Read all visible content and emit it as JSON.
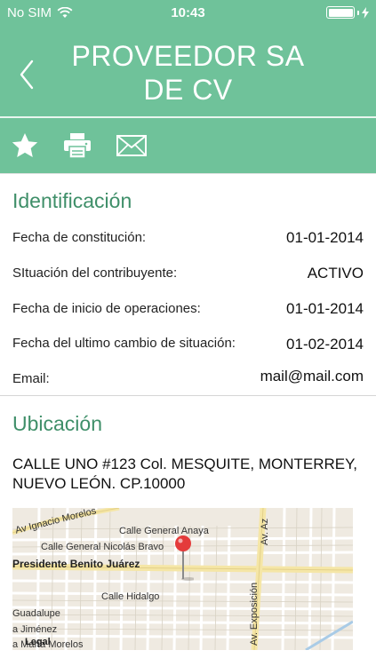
{
  "status_bar": {
    "carrier": "No SIM",
    "time": "10:43",
    "battery_level": 1.0
  },
  "nav": {
    "title": "PROVEEDOR SA DE CV",
    "back_icon": "chevron-left-icon"
  },
  "toolbar": {
    "icons": [
      "star-icon",
      "printer-icon",
      "mail-icon"
    ]
  },
  "identificacion": {
    "title": "Identificación",
    "rows": [
      {
        "label": "Fecha de constitución:",
        "value": "01-01-2014"
      },
      {
        "label": "SItuación del contribuyente:",
        "value": "ACTIVO"
      },
      {
        "label": "Fecha de inicio de operaciones:",
        "value": "01-01-2014"
      },
      {
        "label": "Fecha del ultimo cambio de situación:",
        "value": "01-02-2014"
      },
      {
        "label": "Email:",
        "value": "mail@mail.com"
      }
    ]
  },
  "ubicacion": {
    "title": "Ubicación",
    "address": "CALLE UNO #123 Col. MESQUITE, MONTERREY, NUEVO LEÓN. CP.10000"
  },
  "map": {
    "streets": {
      "ignacio": "Av Ignacio Morelos",
      "anaya": "Calle General Anaya",
      "bravo": "Calle General Nicolás Bravo",
      "juarez": "Presidente Benito Juárez",
      "hidalgo": "Calle Hidalgo",
      "guadalupe": "Guadalupe",
      "jimenez": "a Jiménez",
      "maria": "a María Morelos",
      "exposicion": "Av. Exposición",
      "az": "Av. Az"
    },
    "legal": "Legal",
    "pin_color": "#e43b3b"
  },
  "colors": {
    "header": "#6fc29a",
    "section_title": "#3f8f69"
  }
}
